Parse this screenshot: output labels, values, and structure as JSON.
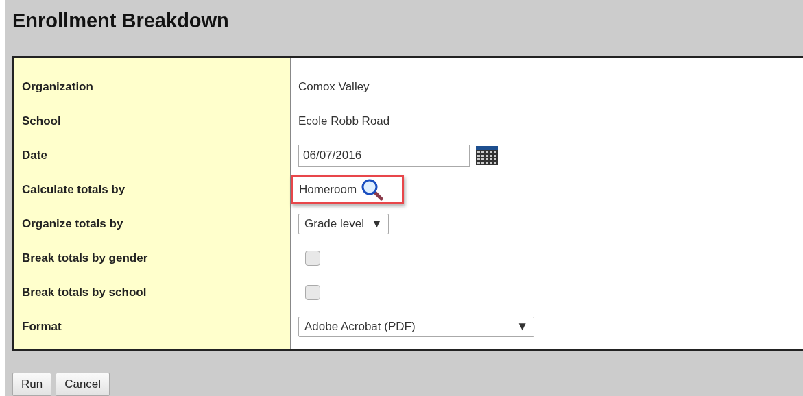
{
  "title": "Enrollment Breakdown",
  "fields": [
    {
      "label": "Organization",
      "kind": "text",
      "value": "Comox Valley"
    },
    {
      "label": "School",
      "kind": "text",
      "value": "Ecole Robb Road"
    },
    {
      "label": "Date",
      "kind": "date",
      "value": "06/07/2016"
    },
    {
      "label": "Calculate totals by",
      "kind": "lookup",
      "value": "Homeroom",
      "highlighted": true
    },
    {
      "label": "Organize totals by",
      "kind": "select",
      "value": "Grade level",
      "arrow": "▼"
    },
    {
      "label": "Break totals by gender",
      "kind": "checkbox",
      "checked": false
    },
    {
      "label": "Break totals by school",
      "kind": "checkbox",
      "checked": false
    },
    {
      "label": "Format",
      "kind": "select",
      "value": "Adobe Acrobat (PDF)",
      "arrow": "▼",
      "wide": true
    }
  ],
  "buttons": [
    "Run",
    "Cancel"
  ]
}
